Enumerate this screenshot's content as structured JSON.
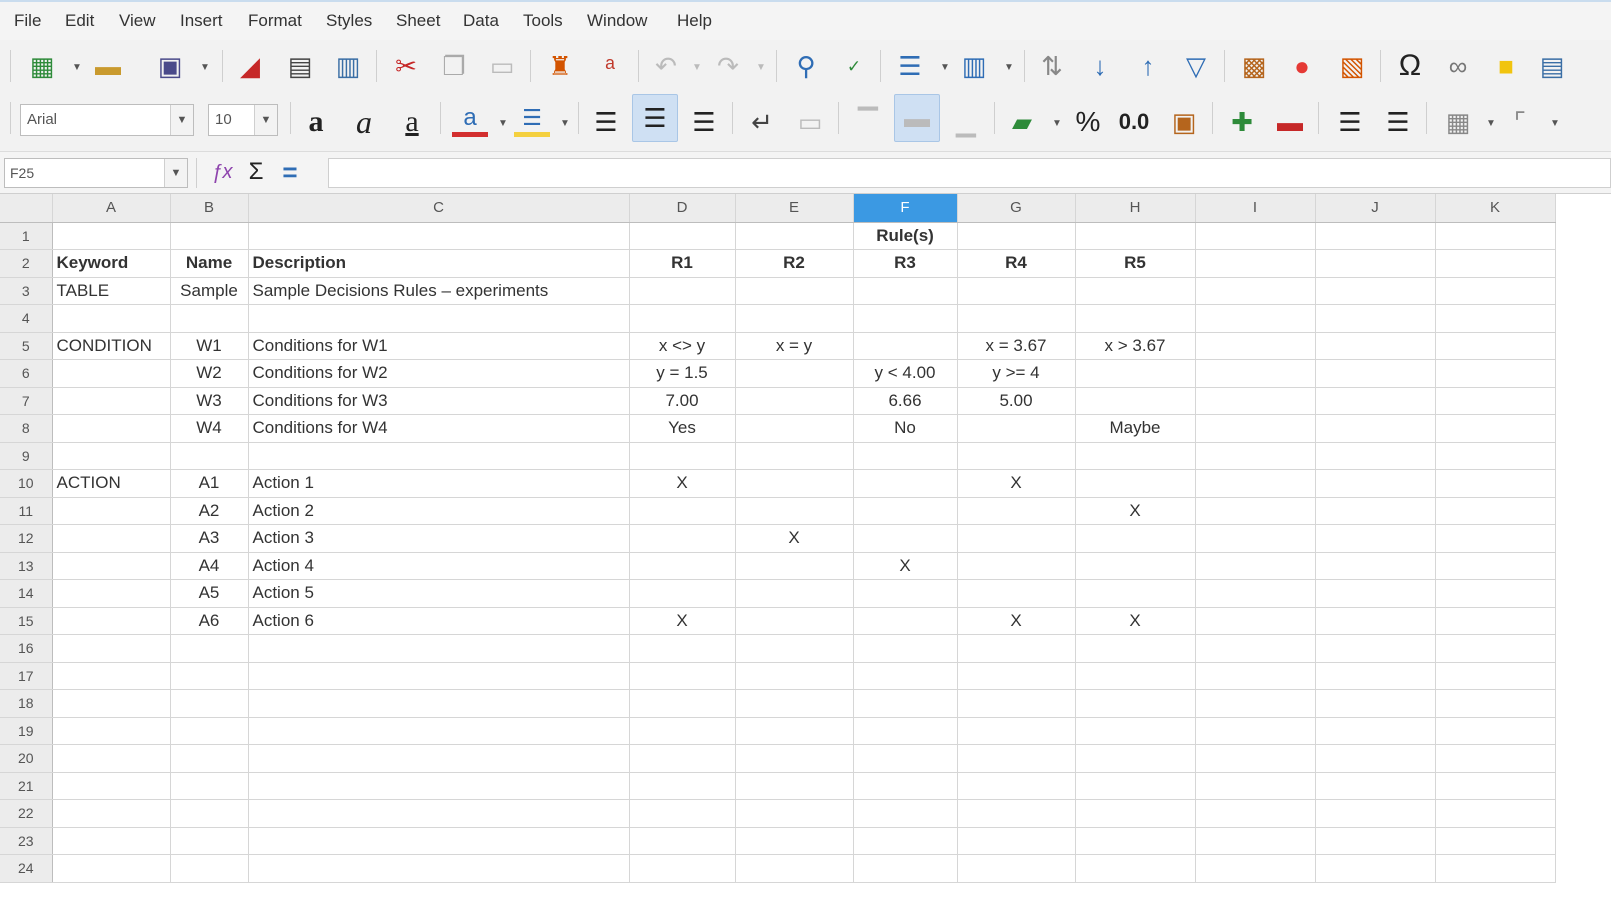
{
  "menu": [
    "File",
    "Edit",
    "View",
    "Insert",
    "Format",
    "Styles",
    "Sheet",
    "Data",
    "Tools",
    "Window",
    "Help"
  ],
  "toolbar": {
    "font_name": "Arial",
    "font_size": "10",
    "percent_glyph": "%",
    "number_glyph": "0.0",
    "omega_glyph": "Ω"
  },
  "formula_bar": {
    "cell_ref": "F25",
    "sum_glyph": "Σ",
    "equals_glyph": "="
  },
  "columns": [
    "A",
    "B",
    "C",
    "D",
    "E",
    "F",
    "G",
    "H",
    "I",
    "J",
    "K"
  ],
  "selected_column": "F",
  "rows": [
    {
      "n": "1",
      "cells": [
        "",
        "",
        "",
        "",
        "",
        "Rule(s)",
        "",
        "",
        "",
        "",
        ""
      ]
    },
    {
      "n": "2",
      "cells": [
        "Keyword",
        "Name",
        "Description",
        "R1",
        "R2",
        "R3",
        "R4",
        "R5",
        "",
        "",
        ""
      ]
    },
    {
      "n": "3",
      "cells": [
        "TABLE",
        "Sample",
        "Sample Decisions Rules – experiments",
        "",
        "",
        "",
        "",
        "",
        "",
        "",
        ""
      ]
    },
    {
      "n": "4",
      "cells": [
        "",
        "",
        "",
        "",
        "",
        "",
        "",
        "",
        "",
        "",
        ""
      ]
    },
    {
      "n": "5",
      "cells": [
        "CONDITION",
        "W1",
        "Conditions for W1",
        "x <> y",
        "x = y",
        "",
        "x = 3.67",
        "x > 3.67",
        "",
        "",
        ""
      ]
    },
    {
      "n": "6",
      "cells": [
        "",
        "W2",
        "Conditions for W2",
        "y = 1.5",
        "",
        "y < 4.00",
        "y >= 4",
        "",
        "",
        "",
        ""
      ]
    },
    {
      "n": "7",
      "cells": [
        "",
        "W3",
        "Conditions for W3",
        "7.00",
        "",
        "6.66",
        "5.00",
        "",
        "",
        "",
        ""
      ]
    },
    {
      "n": "8",
      "cells": [
        "",
        "W4",
        "Conditions for W4",
        "Yes",
        "",
        "No",
        "",
        "Maybe",
        "",
        "",
        ""
      ]
    },
    {
      "n": "9",
      "cells": [
        "",
        "",
        "",
        "",
        "",
        "",
        "",
        "",
        "",
        "",
        ""
      ]
    },
    {
      "n": "10",
      "cells": [
        "ACTION",
        "A1",
        "Action 1",
        "X",
        "",
        "",
        "X",
        "",
        "",
        "",
        ""
      ]
    },
    {
      "n": "11",
      "cells": [
        "",
        "A2",
        "Action 2",
        "",
        "",
        "",
        "",
        "X",
        "",
        "",
        ""
      ]
    },
    {
      "n": "12",
      "cells": [
        "",
        "A3",
        "Action 3",
        "",
        "X",
        "",
        "",
        "",
        "",
        "",
        ""
      ]
    },
    {
      "n": "13",
      "cells": [
        "",
        "A4",
        "Action 4",
        "",
        "",
        "X",
        "",
        "",
        "",
        "",
        ""
      ]
    },
    {
      "n": "14",
      "cells": [
        "",
        "A5",
        "Action 5",
        "",
        "",
        "",
        "",
        "",
        "",
        "",
        ""
      ]
    },
    {
      "n": "15",
      "cells": [
        "",
        "A6",
        "Action 6",
        "X",
        "",
        "",
        "X",
        "X",
        "",
        "",
        ""
      ]
    },
    {
      "n": "16",
      "cells": [
        "",
        "",
        "",
        "",
        "",
        "",
        "",
        "",
        "",
        "",
        ""
      ]
    },
    {
      "n": "17",
      "cells": [
        "",
        "",
        "",
        "",
        "",
        "",
        "",
        "",
        "",
        "",
        ""
      ]
    },
    {
      "n": "18",
      "cells": [
        "",
        "",
        "",
        "",
        "",
        "",
        "",
        "",
        "",
        "",
        ""
      ]
    },
    {
      "n": "19",
      "cells": [
        "",
        "",
        "",
        "",
        "",
        "",
        "",
        "",
        "",
        "",
        ""
      ]
    },
    {
      "n": "20",
      "cells": [
        "",
        "",
        "",
        "",
        "",
        "",
        "",
        "",
        "",
        "",
        ""
      ]
    },
    {
      "n": "21",
      "cells": [
        "",
        "",
        "",
        "",
        "",
        "",
        "",
        "",
        "",
        "",
        ""
      ]
    },
    {
      "n": "22",
      "cells": [
        "",
        "",
        "",
        "",
        "",
        "",
        "",
        "",
        "",
        "",
        ""
      ]
    },
    {
      "n": "23",
      "cells": [
        "",
        "",
        "",
        "",
        "",
        "",
        "",
        "",
        "",
        "",
        ""
      ]
    },
    {
      "n": "24",
      "cells": [
        "",
        "",
        "",
        "",
        "",
        "",
        "",
        "",
        "",
        "",
        ""
      ]
    }
  ],
  "colors": {
    "selected_header": "#3b99e3",
    "header_bg": "#ececec",
    "toolbar_bg": "#f2f2f2"
  }
}
